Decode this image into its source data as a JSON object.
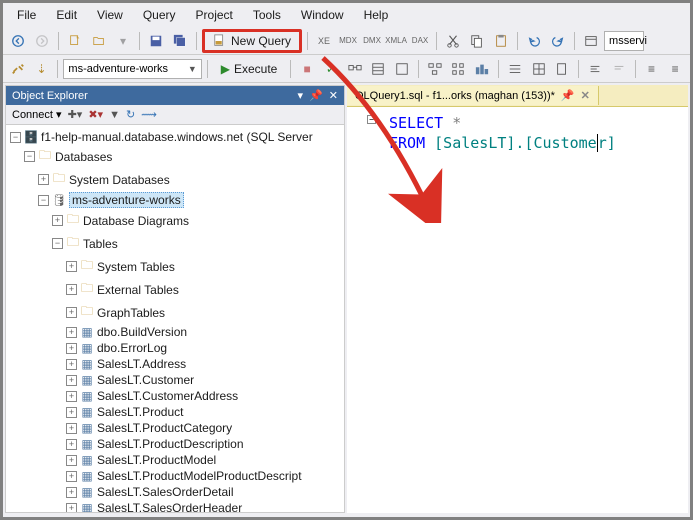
{
  "menubar": {
    "items": [
      "File",
      "Edit",
      "View",
      "Query",
      "Project",
      "Tools",
      "Window",
      "Help"
    ]
  },
  "toolbar1": {
    "new_query_label": "New Query",
    "right_textbox": "msservi"
  },
  "toolbar2": {
    "database_combo": "ms-adventure-works",
    "execute_label": "Execute"
  },
  "object_explorer": {
    "title": "Object Explorer",
    "connect_label": "Connect",
    "server": "f1-help-manual.database.windows.net (SQL Server",
    "nodes": {
      "databases": "Databases",
      "system_databases": "System Databases",
      "db_name": "ms-adventure-works",
      "database_diagrams": "Database Diagrams",
      "tables": "Tables",
      "system_tables": "System Tables",
      "external_tables": "External Tables",
      "graph_tables": "GraphTables",
      "table_list": [
        "dbo.BuildVersion",
        "dbo.ErrorLog",
        "SalesLT.Address",
        "SalesLT.Customer",
        "SalesLT.CustomerAddress",
        "SalesLT.Product",
        "SalesLT.ProductCategory",
        "SalesLT.ProductDescription",
        "SalesLT.ProductModel",
        "SalesLT.ProductModelProductDescript",
        "SalesLT.SalesOrderDetail",
        "SalesLT.SalesOrderHeader"
      ]
    }
  },
  "editor": {
    "tab_label": "QLQuery1.sql - f1...orks (maghan (153))*",
    "code": {
      "kw_select": "SELECT",
      "star": "*",
      "kw_from": "FROM",
      "table_ref_pre": "[SalesLT].[Custome",
      "table_ref_post": "r]"
    }
  }
}
